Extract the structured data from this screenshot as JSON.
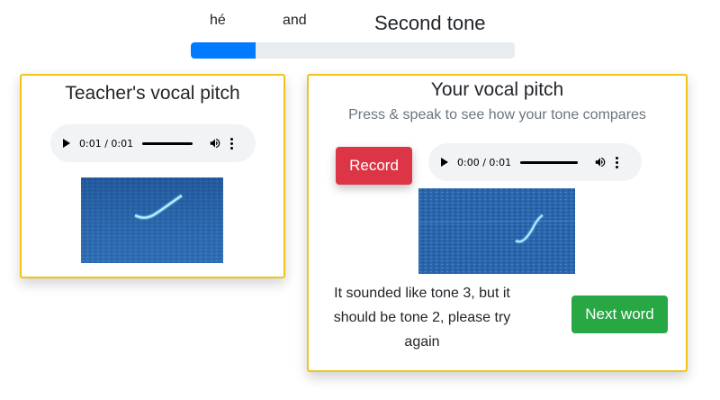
{
  "header": {
    "word1": "hé",
    "word2": "and",
    "tone_title": "Second tone",
    "progress_fraction": 0.2,
    "colors": {
      "progress_fill": "#007bff",
      "progress_track": "#e9ecef"
    }
  },
  "teacher": {
    "title": "Teacher's vocal pitch",
    "audio": {
      "time": "0:01 / 0:01",
      "progress_fraction": 1.0
    },
    "spectrogram_icon": "spectrogram-image"
  },
  "student": {
    "title": "Your vocal pitch",
    "subtitle": "Press & speak to see how your tone compares",
    "record_label": "Record",
    "audio": {
      "time": "0:00 / 0:01",
      "progress_fraction": 1.0
    },
    "spectrogram_icon": "spectrogram-image",
    "feedback": "It sounded like tone 3, but it should be tone 2, please try again",
    "next_label": "Next word"
  },
  "colors": {
    "card_border": "#f0c419",
    "record": "#dc3545",
    "next": "#28a745"
  }
}
